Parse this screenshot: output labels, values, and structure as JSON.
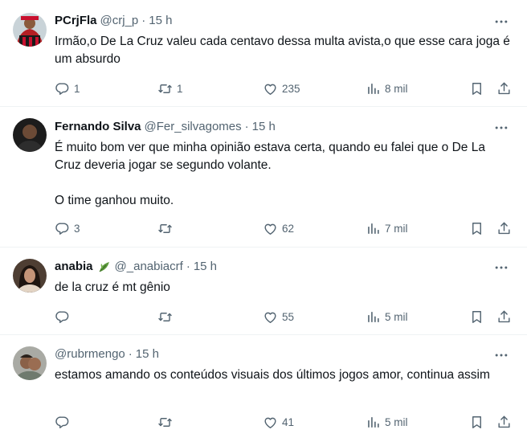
{
  "tweets": [
    {
      "name": "PCrjFla",
      "handle": "@crj_p",
      "dot": "·",
      "time": "15 h",
      "paragraphs": [
        "Irmão,o De La Cruz valeu cada centavo dessa multa avista,o que esse cara joga é um absurdo"
      ],
      "replies": "1",
      "retweets": "1",
      "likes": "235",
      "views": "8 mil"
    },
    {
      "name": "Fernando Silva",
      "handle": "@Fer_silvagomes",
      "dot": "·",
      "time": "15 h",
      "paragraphs": [
        "É muito bom ver que minha opinião estava certa, quando eu falei que o De La Cruz deveria jogar se segundo volante.",
        "O time ganhou muito."
      ],
      "replies": "3",
      "retweets": "",
      "likes": "62",
      "views": "7 mil"
    },
    {
      "name": "anabia",
      "handle": "@_anabiacrf",
      "dot": "·",
      "time": "15 h",
      "paragraphs": [
        "de la cruz é mt gênio"
      ],
      "replies": "",
      "retweets": "",
      "likes": "55",
      "views": "5 mil"
    },
    {
      "name": "",
      "handle": "@rubrmengo",
      "dot": "·",
      "time": "15 h",
      "paragraphs": [
        "estamos amando os conteúdos visuais dos últimos jogos amor, continua assim"
      ],
      "replies": "",
      "retweets": "",
      "likes": "41",
      "views": "5 mil"
    }
  ],
  "colors": {
    "text": "#0f1419",
    "secondary": "#536471",
    "divider": "#eff3f4"
  }
}
